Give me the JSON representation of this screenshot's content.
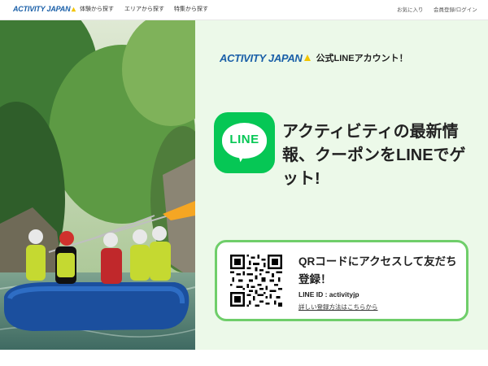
{
  "header": {
    "logo_text": "ACTIVITY JAPAN",
    "nav": [
      {
        "label": "体験から探す"
      },
      {
        "label": "エリアから探す"
      },
      {
        "label": "特集から探す"
      }
    ],
    "right_links": [
      {
        "label": "お気に入り"
      },
      {
        "label": "会員登録/ログイン"
      }
    ]
  },
  "promo": {
    "brand_logo": "ACTIVITY JAPAN",
    "caption": "公式LINEアカウント！",
    "line_icon_text": "LINE",
    "headline": "アクティビティの最新情報、クーポンをLINEでゲット!",
    "qr_card": {
      "title": "QRコードにアクセスして友だち登録！",
      "line_id": "LINE ID : activityjp",
      "help_link": "詳しい登録方法はこちらから"
    }
  },
  "colors": {
    "brand_blue": "#1a5fa8",
    "line_green": "#06c755",
    "panel_bg": "#ecf9e9",
    "card_border": "#6fce6a"
  },
  "icons": [
    "activity-japan-logo",
    "line-app-icon",
    "qr-code"
  ]
}
